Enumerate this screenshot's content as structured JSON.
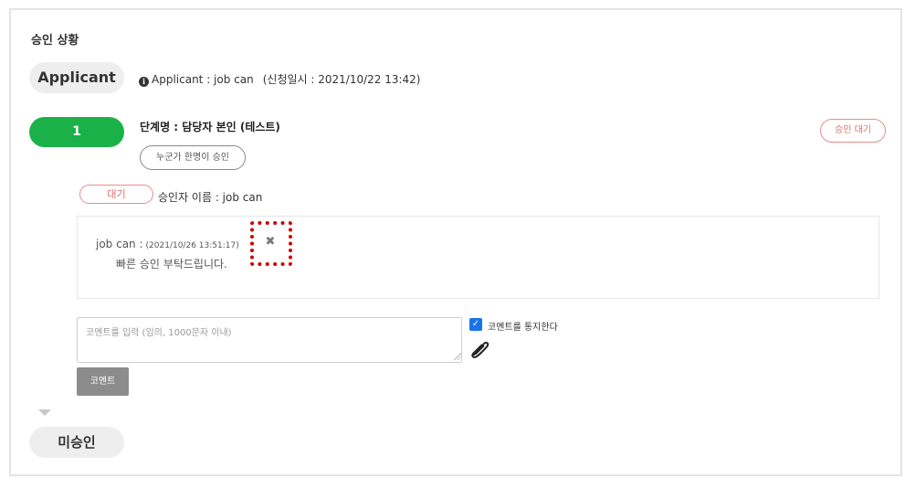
{
  "section": {
    "title": "승인 상황"
  },
  "applicant": {
    "badge": "Applicant",
    "icon": "info-circle-icon",
    "info": "Applicant : job can",
    "date": "(신청일시 : 2021/10/22 13:42)"
  },
  "step": {
    "number": "1",
    "name": "단계명 : 담당자 본인 (테스트)",
    "rule_button": "누군가 한명이 승인",
    "status_badge": "승인 대기"
  },
  "approver": {
    "status": "대기",
    "name": "승인자 이름 : job can"
  },
  "comment": {
    "author": "job can :",
    "time": "(2021/10/26 13:51:17)",
    "delete_icon": "close-x-icon",
    "delete_symbol": "✖",
    "text": "빠른 승인 부탁드립니다."
  },
  "new_comment": {
    "placeholder": "코멘트를 입력 (임의, 1000문자 이내)",
    "notify_label": "코멘트를 통지한다",
    "notify_checked": true,
    "attach_icon": "paperclip-icon",
    "submit_label": "코멘트"
  },
  "next_step": {
    "badge": "미승인"
  },
  "colors": {
    "step_green": "#1ab248",
    "pending_red": "#e46a6a",
    "highlight_red": "#cc0000",
    "check_blue": "#1a73e8"
  }
}
